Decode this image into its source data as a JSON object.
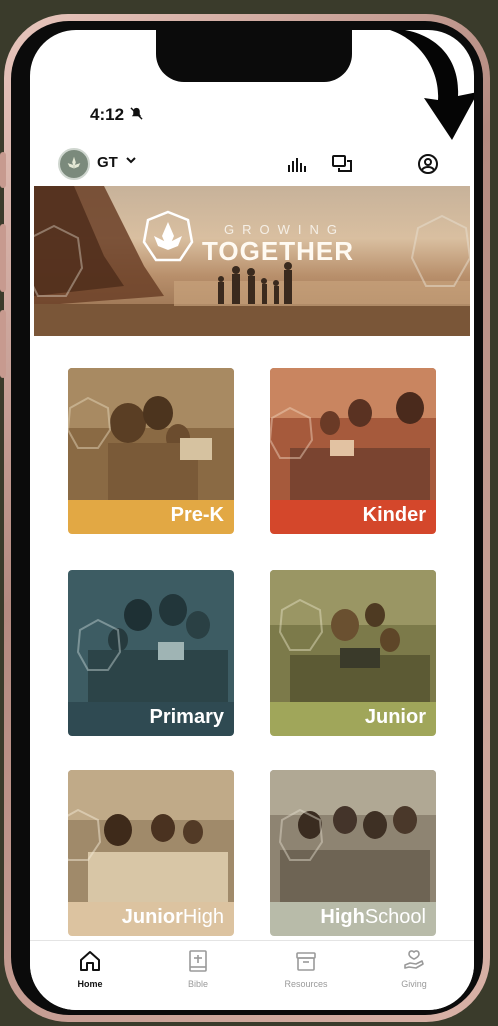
{
  "status_bar": {
    "time": "4:12"
  },
  "header": {
    "org_initials": "GT"
  },
  "banner": {
    "title_small": "GROWING",
    "title_big": "TOGETHER"
  },
  "tiles": [
    {
      "label": "Pre-K",
      "color": "#e2a844"
    },
    {
      "label": "Kinder",
      "color": "#d4472b"
    },
    {
      "label": "Primary",
      "color": "#2f4a52"
    },
    {
      "label": "Junior",
      "color": "#a0a65a"
    },
    {
      "label_bold": "Junior",
      "label_regular": "High",
      "color": "#dcc3a0"
    },
    {
      "label_bold": "High",
      "label_regular": "School",
      "color": "#b8bba9"
    }
  ],
  "bottom_nav": [
    {
      "label": "Home",
      "icon": "home-icon",
      "active": true
    },
    {
      "label": "Bible",
      "icon": "bible-icon",
      "active": false
    },
    {
      "label": "Resources",
      "icon": "archive-icon",
      "active": false
    },
    {
      "label": "Giving",
      "icon": "giving-icon",
      "active": false
    }
  ]
}
